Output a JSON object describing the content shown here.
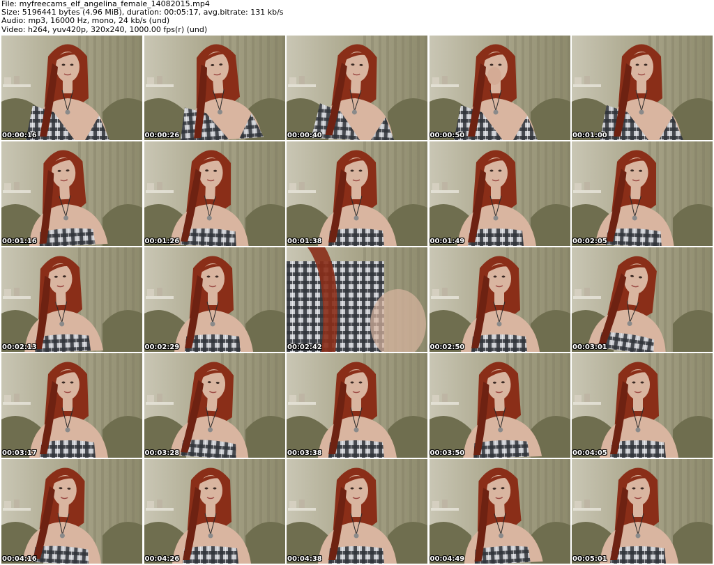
{
  "header": {
    "line_file": "File: myfreecams_elf_angelina_female_14082015.mp4",
    "line_size": "Size: 5196441 bytes (4.96 MiB), duration: 00:05:17, avg.bitrate: 131 kb/s",
    "line_audio": "Audio: mp3, 16000 Hz, mono, 24 kb/s (und)",
    "line_video": "Video: h264, yuv420p, 320x240, 1000.00 fps(r) (und)"
  },
  "frames": [
    {
      "timestamp": "00:00:16"
    },
    {
      "timestamp": "00:00:26"
    },
    {
      "timestamp": "00:00:40"
    },
    {
      "timestamp": "00:00:50"
    },
    {
      "timestamp": "00:01:00"
    },
    {
      "timestamp": "00:01:16"
    },
    {
      "timestamp": "00:01:26"
    },
    {
      "timestamp": "00:01:38"
    },
    {
      "timestamp": "00:01:49"
    },
    {
      "timestamp": "00:02:05"
    },
    {
      "timestamp": "00:02:13"
    },
    {
      "timestamp": "00:02:29"
    },
    {
      "timestamp": "00:02:42"
    },
    {
      "timestamp": "00:02:50"
    },
    {
      "timestamp": "00:03:01"
    },
    {
      "timestamp": "00:03:17"
    },
    {
      "timestamp": "00:03:28"
    },
    {
      "timestamp": "00:03:38"
    },
    {
      "timestamp": "00:03:50"
    },
    {
      "timestamp": "00:04:05"
    },
    {
      "timestamp": "00:04:16"
    },
    {
      "timestamp": "00:04:26"
    },
    {
      "timestamp": "00:04:38"
    },
    {
      "timestamp": "00:04:49"
    },
    {
      "timestamp": "00:05:01"
    }
  ],
  "colors": {
    "background": "#ffffff",
    "header_text": "#000000",
    "timestamp_text": "#ffffff",
    "timestamp_outline": "#000000",
    "curtain": "#a9a58a",
    "wall": "#c9c6b4",
    "chair": "#6f6e4f",
    "hair": "#8a2e18",
    "skin": "#d9b5a0",
    "plaid_dark": "#2f3238",
    "plaid_light": "#c9cbd0"
  }
}
